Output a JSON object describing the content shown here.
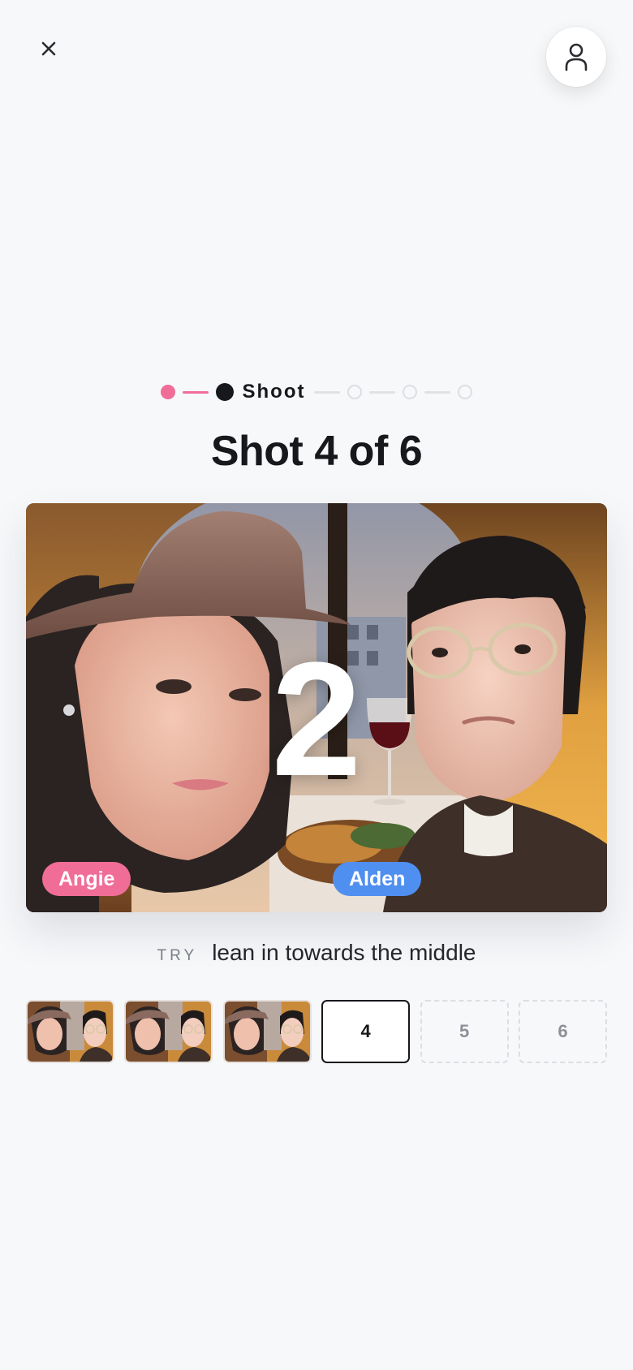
{
  "header": {
    "close_icon": "close-icon",
    "profile_icon": "user-icon"
  },
  "stepper": {
    "steps": [
      {
        "state": "done"
      },
      {
        "state": "active",
        "label": "Shoot"
      },
      {
        "state": "pending"
      },
      {
        "state": "pending"
      },
      {
        "state": "pending"
      }
    ],
    "colors": {
      "done": "#f06d98",
      "active": "#16181c",
      "pending": "#dcdee3"
    }
  },
  "title": "Shot 4 of 6",
  "photo": {
    "countdown": "2",
    "left_name": "Angie",
    "right_name": "Alden",
    "left_color": "#f06d98",
    "right_color": "#4f8ff0"
  },
  "tip": {
    "prefix": "TRY",
    "text": "lean in towards the middle"
  },
  "thumbnails": [
    {
      "state": "filled"
    },
    {
      "state": "filled"
    },
    {
      "state": "filled"
    },
    {
      "state": "current",
      "label": "4"
    },
    {
      "state": "empty",
      "label": "5"
    },
    {
      "state": "empty",
      "label": "6"
    }
  ]
}
